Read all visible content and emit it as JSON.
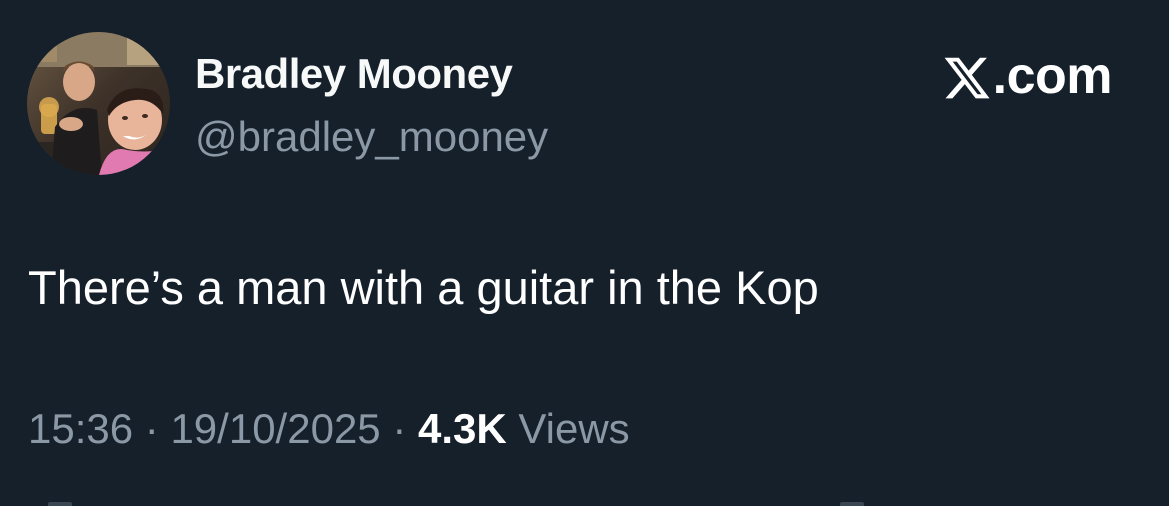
{
  "author": {
    "display_name": "Bradley Mooney",
    "handle": "@bradley_mooney",
    "avatar_icon": "profile-photo"
  },
  "brand": {
    "logo_icon": "x-logo-icon",
    "text": ".com"
  },
  "tweet": {
    "text": "There’s a man with a guitar in the Kop"
  },
  "meta": {
    "time": "15:36",
    "separator": "·",
    "date": "19/10/2025",
    "views_count": "4.3K",
    "views_label": "Views"
  },
  "colors": {
    "background": "#15202b",
    "primary_text": "#ffffff",
    "secondary_text": "#8b98a5"
  }
}
